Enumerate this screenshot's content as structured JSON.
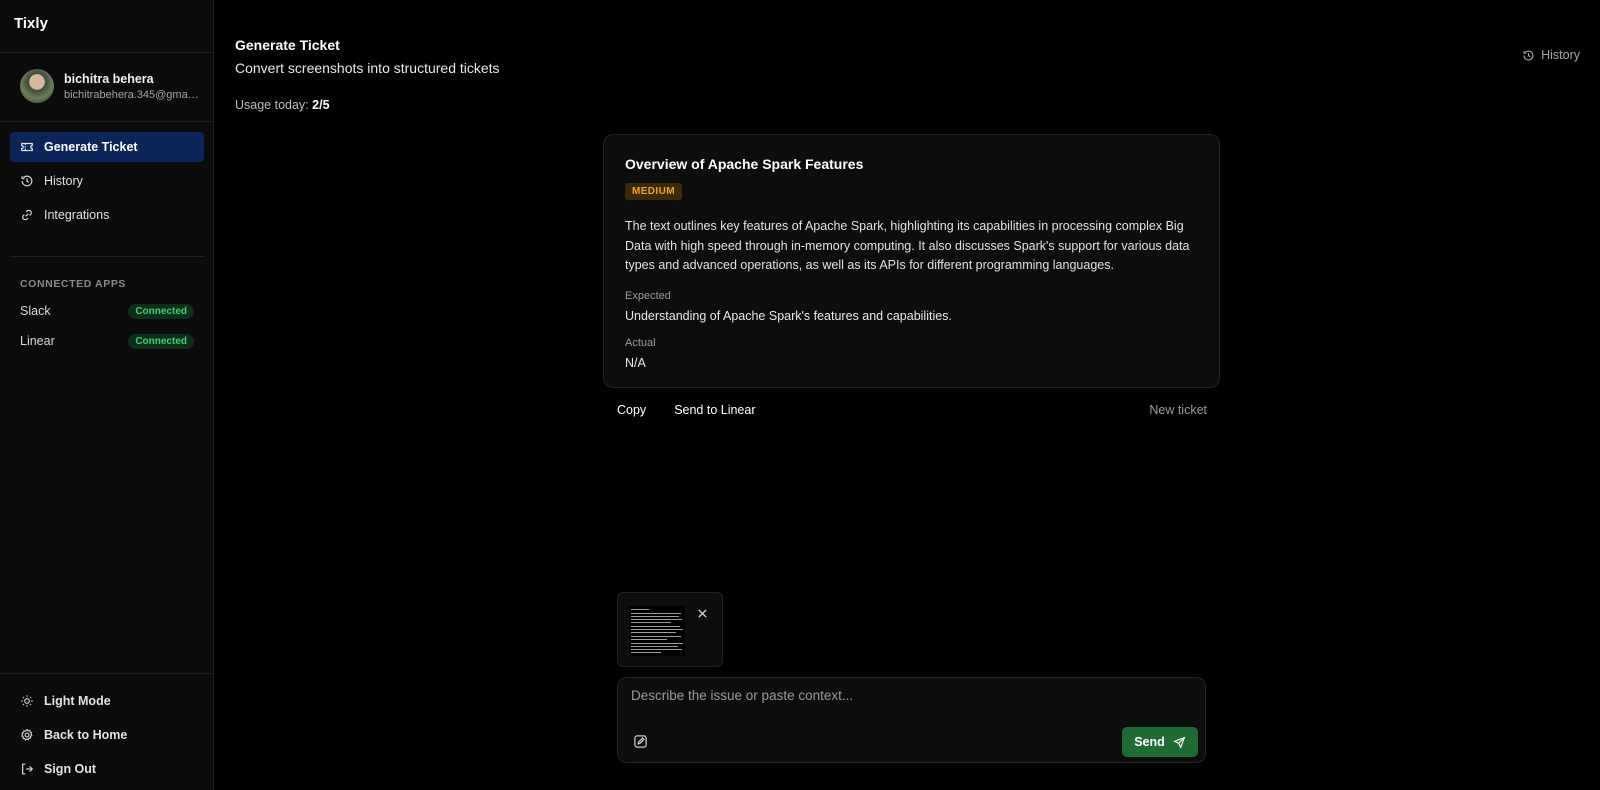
{
  "app": {
    "brand": "Tixly"
  },
  "user": {
    "name": "bichitra behera",
    "email": "bichitrabehera.345@gmail.com"
  },
  "sidebar": {
    "items": [
      {
        "label": "Generate Ticket",
        "icon": "ticket-icon",
        "active": true
      },
      {
        "label": "History",
        "icon": "history-icon",
        "active": false
      },
      {
        "label": "Integrations",
        "icon": "link-icon",
        "active": false
      }
    ],
    "apps_title": "CONNECTED APPS",
    "apps": [
      {
        "name": "Slack",
        "status": "Connected"
      },
      {
        "name": "Linear",
        "status": "Connected"
      }
    ],
    "bottom": [
      {
        "label": "Light Mode",
        "icon": "sun-icon"
      },
      {
        "label": "Back to Home",
        "icon": "gear-icon"
      },
      {
        "label": "Sign Out",
        "icon": "sign-out-icon"
      }
    ]
  },
  "header": {
    "title": "Generate Ticket",
    "subtitle": "Convert screenshots into structured tickets",
    "usage_label": "Usage today:",
    "usage_value": "2/5",
    "history_label": "History"
  },
  "ticket": {
    "title": "Overview of Apache Spark Features",
    "priority": "MEDIUM",
    "description": "The text outlines key features of Apache Spark, highlighting its capabilities in processing complex Big Data with high speed through in-memory computing. It also discusses Spark's support for various data types and advanced operations, as well as its APIs for different programming languages.",
    "expected_label": "Expected",
    "expected_value": "Understanding of Apache Spark's features and capabilities.",
    "actual_label": "Actual",
    "actual_value": "N/A"
  },
  "actions": {
    "copy": "Copy",
    "send_to_linear": "Send to Linear",
    "new_ticket": "New ticket"
  },
  "composer": {
    "placeholder": "Describe the issue or paste context...",
    "send_label": "Send"
  },
  "colors": {
    "accent_active_nav": "#0b2558",
    "connected": "#3fd072",
    "priority_medium": "#f2a423",
    "send_button": "#1f6b34"
  }
}
